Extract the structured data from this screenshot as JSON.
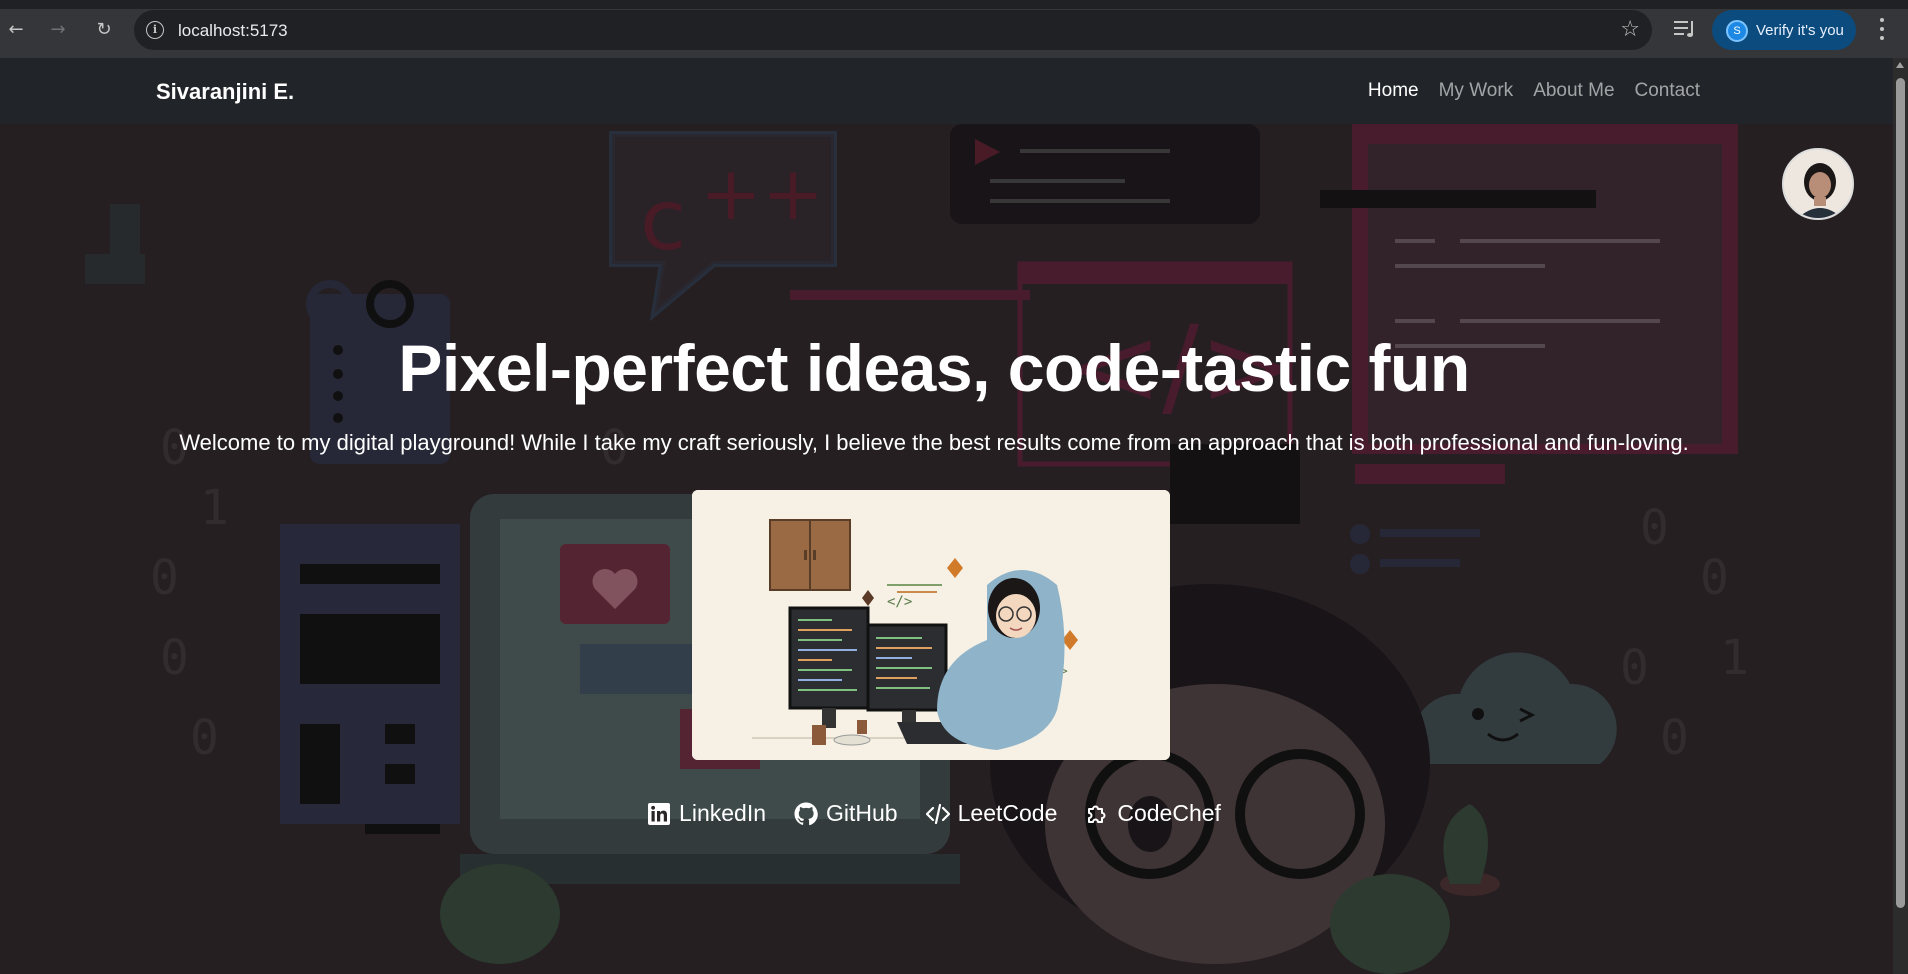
{
  "browser": {
    "url": "localhost:5173",
    "verify_label": "Verify it's you",
    "profile_initial": "S",
    "icons": [
      "back-icon",
      "forward-icon",
      "reload-icon",
      "site-info-icon",
      "bookmark-star-icon",
      "media-controls-icon",
      "kebab-menu-icon"
    ]
  },
  "navbar": {
    "brand": "Sivaranjini E.",
    "links": [
      {
        "label": "Home",
        "active": true
      },
      {
        "label": "My Work",
        "active": false
      },
      {
        "label": "About Me",
        "active": false
      },
      {
        "label": "Contact",
        "active": false
      }
    ]
  },
  "hero": {
    "title": "Pixel-perfect ideas, code-tastic fun",
    "subtitle": "Welcome to my digital playground! While I take my craft seriously, I believe the best results come from an approach that is both professional and fun-loving."
  },
  "socials": [
    {
      "label": "LinkedIn",
      "icon": "linkedin-icon"
    },
    {
      "label": "GitHub",
      "icon": "github-icon"
    },
    {
      "label": "LeetCode",
      "icon": "code-icon"
    },
    {
      "label": "CodeChef",
      "icon": "puzzle-icon"
    }
  ],
  "colors": {
    "navbar_bg": "#212529",
    "chrome_bg": "#35363a",
    "verify_bg": "#0b4b7d",
    "card_bg": "#f6f1e4",
    "accent_pink": "#7a2c45"
  }
}
